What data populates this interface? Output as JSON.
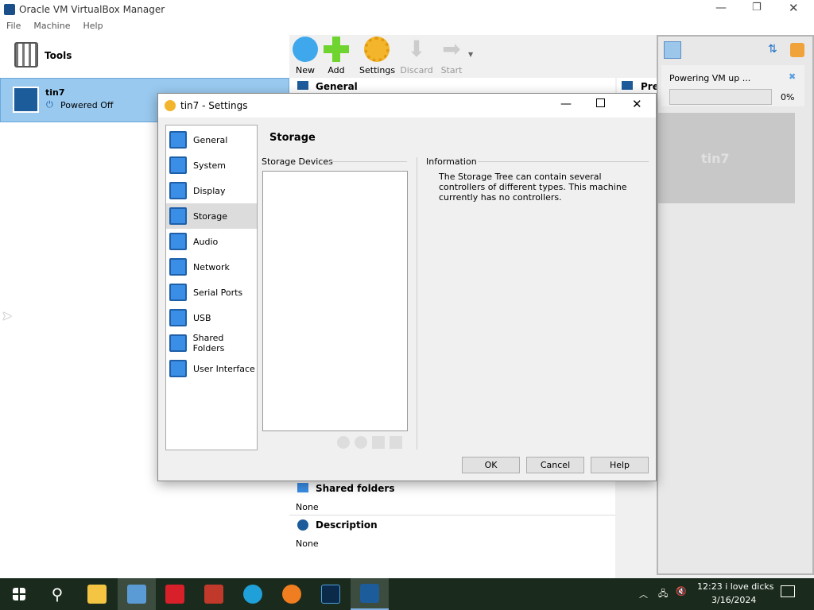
{
  "window": {
    "title": "Oracle VM VirtualBox Manager"
  },
  "menu": [
    "File",
    "Machine",
    "Help"
  ],
  "tools_label": "Tools",
  "vm": {
    "name": "tin7",
    "state": "Powered Off"
  },
  "toolbar": {
    "new": "New",
    "add": "Add",
    "settings": "Settings",
    "discard": "Discard",
    "start": "Start"
  },
  "details": {
    "general": "General",
    "preview": "Preview",
    "shared_folders": "Shared folders",
    "shared_folders_value": "None",
    "description": "Description",
    "description_value": "None"
  },
  "notification": {
    "text": "Powering VM up ...",
    "progress_label": "0%",
    "progress": 0,
    "preview_name": "tin7"
  },
  "dialog": {
    "title": "tin7 - Settings",
    "page_title": "Storage",
    "storage_devices": "Storage Devices",
    "information": "Information",
    "info_text": "The Storage Tree can contain several controllers of different types. This machine currently has no controllers.",
    "nav": [
      "General",
      "System",
      "Display",
      "Storage",
      "Audio",
      "Network",
      "Serial Ports",
      "USB",
      "Shared Folders",
      "User Interface"
    ],
    "selected": "Storage",
    "ok": "OK",
    "cancel": "Cancel",
    "help": "Help"
  },
  "taskbar": {
    "time": "12:23 i love dicks",
    "date": "3/16/2024"
  },
  "colors": {
    "selection": "#99c9ef",
    "taskbar": "#1a2a1c"
  }
}
